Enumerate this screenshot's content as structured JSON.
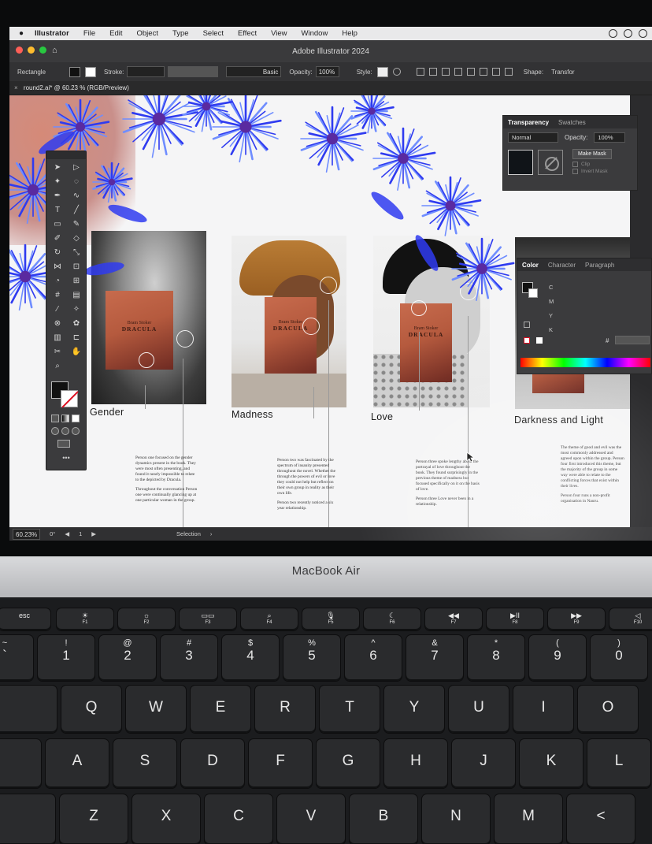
{
  "menubar": {
    "app_name": "Illustrator",
    "items": [
      "File",
      "Edit",
      "Object",
      "Type",
      "Select",
      "Effect",
      "View",
      "Window",
      "Help"
    ]
  },
  "window": {
    "title": "Adobe Illustrator 2024"
  },
  "control_bar": {
    "object_type": "Rectangle",
    "stroke_label": "Stroke:",
    "brush_label": "Basic",
    "opacity_label": "Opacity:",
    "opacity_value": "100%",
    "style_label": "Style:",
    "shape_label": "Shape:",
    "transform_label": "Transfor"
  },
  "document_tab": {
    "label": "round2.ai* @ 60.23 % (RGB/Preview)"
  },
  "artboard": {
    "book_author": "Bram Stoker",
    "book_title": "DRACULA",
    "captions": [
      "Gender",
      "Madness",
      "Love",
      "Darkness and Light"
    ],
    "paragraphs": [
      [
        "Person one focused on the gender dynamics present in the book. They were most often presenting, and found it nearly impossible to relate to the depicted by Dracula.",
        "Throughout the conversation Person one were continually glancing up at one particular woman in the group."
      ],
      [
        "Person two was fascinated by the spectrum of insanity presented throughout the novel. Whether the through the powers of evil or love they could not help but reflect on their own group in reality as their own life.",
        "Person two recently noticed a six year relationship."
      ],
      [
        "Person three spoke lengthy about the portrayal of love throughout the book. They found surprisingly in the previous theme of madness but focused specifically on it on the basis of love.",
        "Person three Love never been in a relationship."
      ],
      [
        "The theme of good and evil was the most commonly addressed and agreed upon within the group. Person four first introduced this theme, but the majority of the group in some way were able to relate to the conflicting forces that exist within their lives.",
        "Person four runs a non-profit organisation in Nauru."
      ]
    ]
  },
  "status_bar": {
    "zoom": "60.23%",
    "rotation": "0°",
    "artboard_index": "1",
    "tool_name": "Selection"
  },
  "transparency_panel": {
    "tab_active": "Transparency",
    "tab_inactive": "Swatches",
    "blend_mode": "Normal",
    "opacity_label": "Opacity:",
    "opacity_value": "100%",
    "make_mask_label": "Make Mask",
    "clip_label": "Clip",
    "invert_label": "Invert Mask"
  },
  "color_panel": {
    "tabs": [
      "Color",
      "Character",
      "Paragraph"
    ],
    "channels": [
      "C",
      "M",
      "Y",
      "K"
    ],
    "hash": "#"
  },
  "laptop": {
    "brand": "MacBook Air"
  },
  "keyboard": {
    "fn_row": [
      {
        "main": "esc",
        "sub": ""
      },
      {
        "main": "☀",
        "sub": "F1"
      },
      {
        "main": "☼",
        "sub": "F2"
      },
      {
        "main": "▭▭",
        "sub": "F3"
      },
      {
        "main": "⌕",
        "sub": "F4"
      },
      {
        "main": "🎙",
        "sub": "F5"
      },
      {
        "main": "☾",
        "sub": "F6"
      },
      {
        "main": "◀◀",
        "sub": "F7"
      },
      {
        "main": "▶II",
        "sub": "F8"
      },
      {
        "main": "▶▶",
        "sub": "F9"
      },
      {
        "main": "◁",
        "sub": "F10"
      }
    ],
    "number_row": [
      {
        "top": "~",
        "main": "`"
      },
      {
        "top": "!",
        "main": "1"
      },
      {
        "top": "@",
        "main": "2"
      },
      {
        "top": "#",
        "main": "3"
      },
      {
        "top": "$",
        "main": "4"
      },
      {
        "top": "%",
        "main": "5"
      },
      {
        "top": "^",
        "main": "6"
      },
      {
        "top": "&",
        "main": "7"
      },
      {
        "top": "*",
        "main": "8"
      },
      {
        "top": "(",
        "main": "9"
      },
      {
        "top": ")",
        "main": "0"
      }
    ],
    "qwerty_row": [
      "Q",
      "W",
      "E",
      "R",
      "T",
      "Y",
      "U",
      "I",
      "O"
    ],
    "home_row": [
      "A",
      "S",
      "D",
      "F",
      "G",
      "H",
      "J",
      "K",
      "L"
    ],
    "bottom_row": [
      "Z",
      "X",
      "C",
      "V",
      "B",
      "N",
      "M",
      "<"
    ]
  },
  "colors": {
    "flower_blue": "#2f3bf0",
    "flower_light": "#6f8dff",
    "salmon": "#d58a78",
    "ui_dark": "#323234"
  }
}
